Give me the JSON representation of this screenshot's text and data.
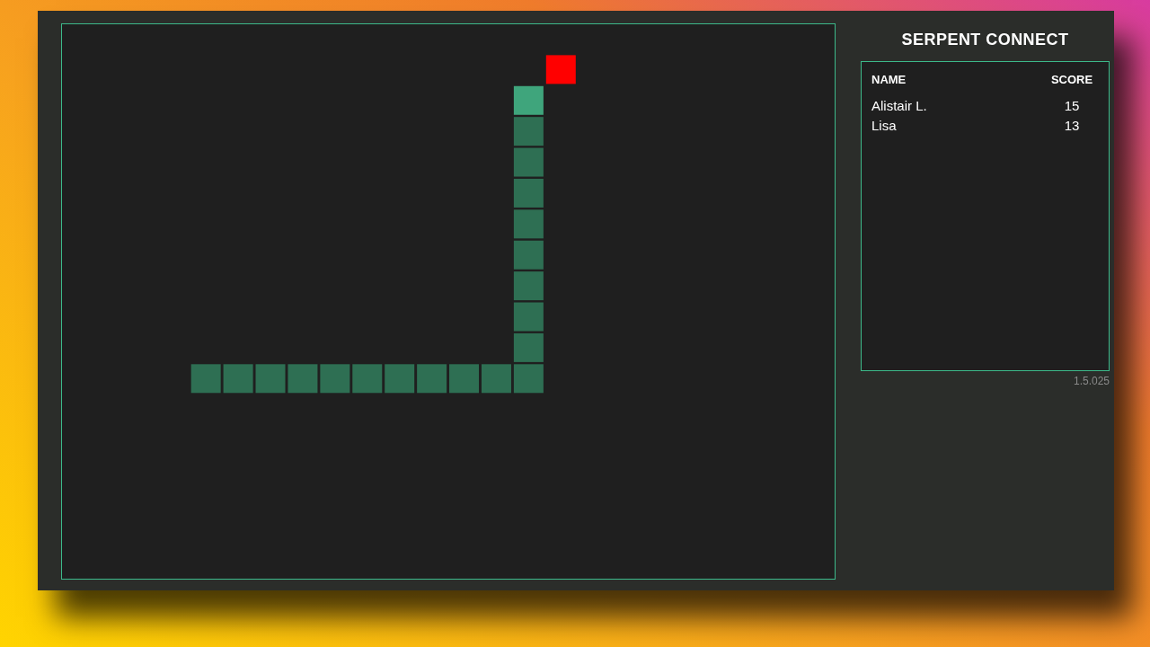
{
  "title": "SERPENT CONNECT",
  "leaderboard": {
    "columns": [
      "NAME",
      "SCORE"
    ],
    "rows": [
      {
        "name": "Alistair L.",
        "score": "15"
      },
      {
        "name": "Lisa",
        "score": "13"
      }
    ]
  },
  "version": "1.5.025"
}
